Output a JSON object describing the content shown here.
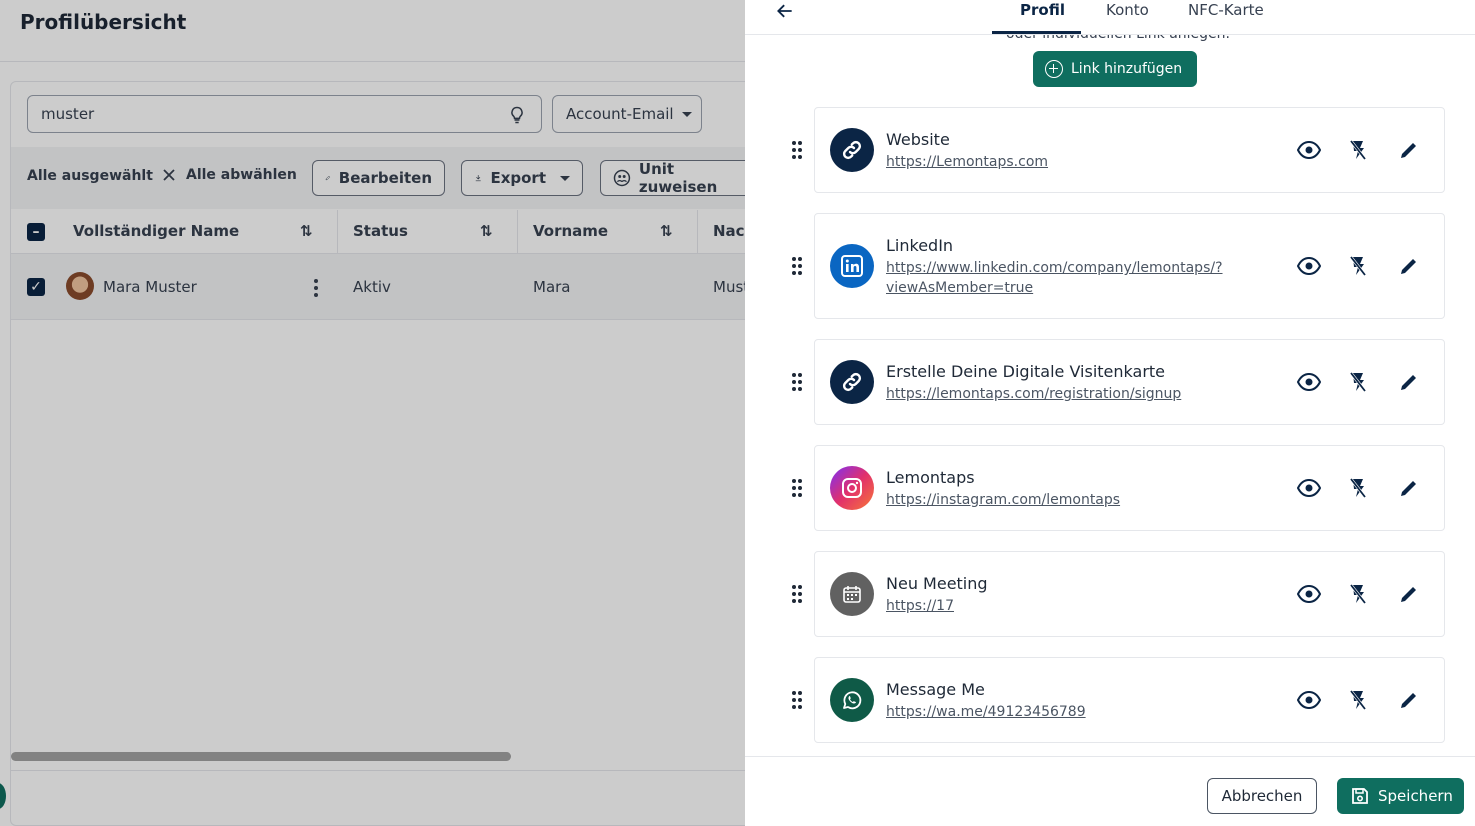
{
  "page": {
    "title": "Profilübersicht",
    "search": {
      "value": "muster"
    },
    "filter_label": "Account-Email",
    "bulk": {
      "all_selected": "Alle ausgewählt",
      "deselect_all": "Alle abwählen",
      "edit": "Bearbeiten",
      "export": "Export",
      "assign_unit": "Unit zuweisen"
    },
    "table": {
      "headers": [
        "Vollständiger Name",
        "Status",
        "Vorname",
        "Nach"
      ],
      "rows": [
        {
          "name": "Mara Muster",
          "status": "Aktiv",
          "first_name": "Mara",
          "last_name": "Must"
        }
      ]
    }
  },
  "drawer": {
    "tabs": [
      {
        "label": "Profil",
        "active": true
      },
      {
        "label": "Konto",
        "active": false
      },
      {
        "label": "NFC-Karte",
        "active": false
      }
    ],
    "cut_text": "oder individuellen Link anlegen.",
    "add_link": "Link hinzufügen",
    "links": [
      {
        "title": "Website",
        "url": "https://Lemontaps.com",
        "icon": "link-icon",
        "color": "#0b2545"
      },
      {
        "title": "LinkedIn",
        "url": "https://www.linkedin.com/company/lemontaps/?viewAsMember=true",
        "url_line1": "https://www.linkedin.com/company/lemontaps/?",
        "url_line2": "viewAsMember=true",
        "icon": "linkedin-icon",
        "color": "#0a66c2"
      },
      {
        "title": "Erstelle Deine Digitale Visitenkarte",
        "url": "https://lemontaps.com/registration/signup",
        "icon": "link-icon",
        "color": "#0b2545"
      },
      {
        "title": "Lemontaps",
        "url": "https://instagram.com/lemontaps",
        "icon": "instagram-icon",
        "color": "#e1306c"
      },
      {
        "title": "Neu Meeting",
        "url": "https://17",
        "icon": "calendar-icon",
        "color": "#616161"
      },
      {
        "title": "Message Me",
        "url": "https://wa.me/49123456789",
        "icon": "whatsapp-icon",
        "color": "#0f5a47"
      }
    ],
    "footer": {
      "cancel": "Abbrechen",
      "save": "Speichern"
    }
  },
  "colors": {
    "primary": "#0f6e5f",
    "navy": "#0b2545"
  }
}
